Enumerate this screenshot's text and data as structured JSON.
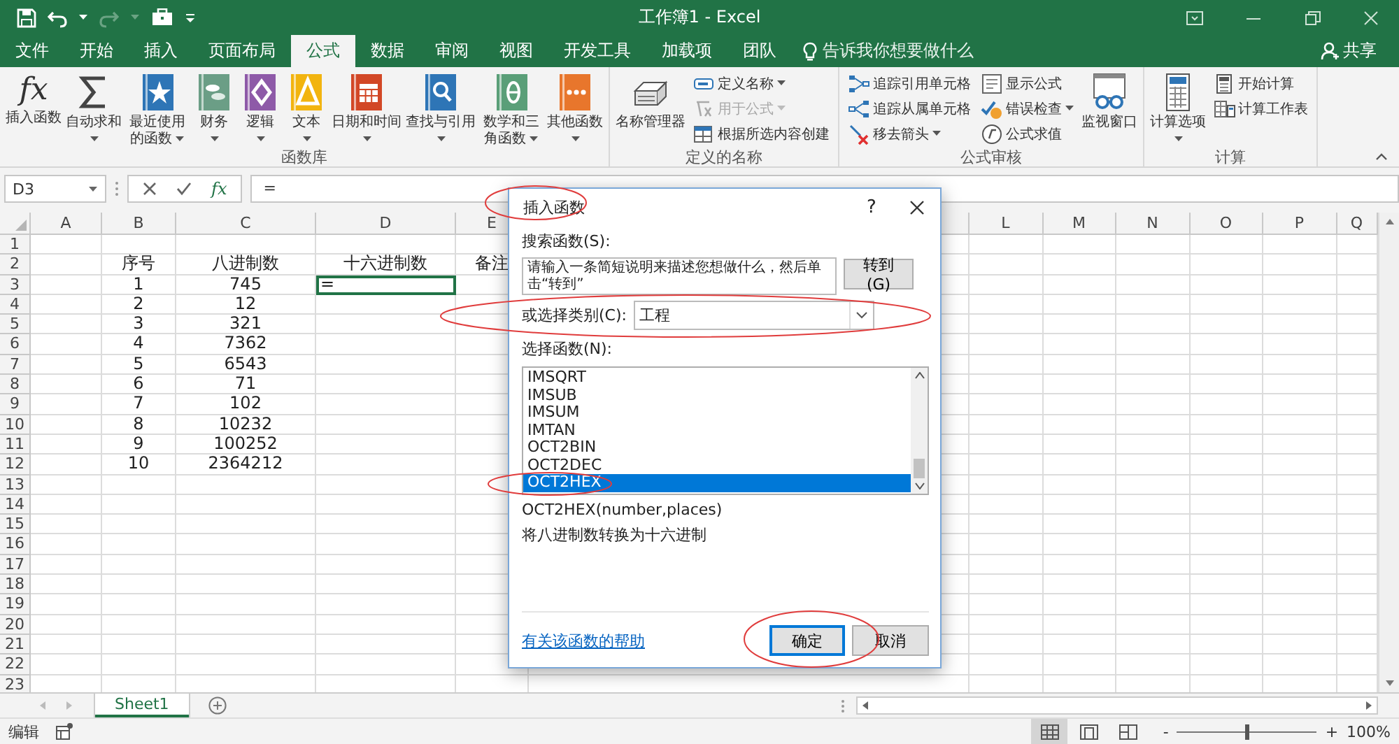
{
  "window": {
    "title": "工作簿1 - Excel"
  },
  "tabs": [
    {
      "label": "文件",
      "selected": false
    },
    {
      "label": "开始",
      "selected": false
    },
    {
      "label": "插入",
      "selected": false
    },
    {
      "label": "页面布局",
      "selected": false
    },
    {
      "label": "公式",
      "selected": true
    },
    {
      "label": "数据",
      "selected": false
    },
    {
      "label": "审阅",
      "selected": false
    },
    {
      "label": "视图",
      "selected": false
    },
    {
      "label": "开发工具",
      "selected": false
    },
    {
      "label": "加载项",
      "selected": false
    },
    {
      "label": "团队",
      "selected": false
    }
  ],
  "tell_me": {
    "placeholder": "告诉我你想要做什么"
  },
  "share": "共享",
  "ribbon": {
    "groups": [
      {
        "label": "函数库",
        "items": [
          {
            "kind": "large",
            "label": "插入函数",
            "glyph": "fx",
            "dropdown": false,
            "disabled": false
          },
          {
            "kind": "large",
            "label": "自动求和",
            "dropdown": true,
            "disabled": false
          },
          {
            "kind": "large",
            "label": "最近使用的函数",
            "dropdown": true,
            "disabled": false
          },
          {
            "kind": "large",
            "label": "财务",
            "dropdown": true,
            "disabled": false
          },
          {
            "kind": "large",
            "label": "逻辑",
            "dropdown": true,
            "disabled": false
          },
          {
            "kind": "large",
            "label": "文本",
            "dropdown": true,
            "disabled": false
          },
          {
            "kind": "large",
            "label": "日期和时间",
            "dropdown": true,
            "disabled": false
          },
          {
            "kind": "large",
            "label": "查找与引用",
            "dropdown": true,
            "disabled": false
          },
          {
            "kind": "large",
            "label": "数学和三角函数",
            "dropdown": true,
            "disabled": false
          },
          {
            "kind": "large",
            "label": "其他函数",
            "dropdown": true,
            "disabled": false
          }
        ]
      },
      {
        "label": "定义的名称",
        "items": [
          {
            "kind": "large",
            "label": "名称管理器",
            "dropdown": false,
            "disabled": false
          },
          {
            "kind": "small",
            "label": "定义名称",
            "dropdown": true,
            "disabled": false
          },
          {
            "kind": "small",
            "label": "用于公式",
            "dropdown": true,
            "disabled": true
          },
          {
            "kind": "small",
            "label": "根据所选内容创建",
            "dropdown": false,
            "disabled": false
          }
        ]
      },
      {
        "label": "公式审核",
        "items": [
          {
            "kind": "small",
            "label": "追踪引用单元格",
            "dropdown": false,
            "disabled": false
          },
          {
            "kind": "small",
            "label": "追踪从属单元格",
            "dropdown": false,
            "disabled": false
          },
          {
            "kind": "small",
            "label": "移去箭头",
            "dropdown": true,
            "disabled": false
          },
          {
            "kind": "small",
            "label": "显示公式",
            "dropdown": false,
            "disabled": false
          },
          {
            "kind": "small",
            "label": "错误检查",
            "dropdown": true,
            "disabled": false
          },
          {
            "kind": "small",
            "label": "公式求值",
            "dropdown": false,
            "disabled": false
          },
          {
            "kind": "large",
            "label": "监视窗口",
            "dropdown": false,
            "disabled": false
          }
        ]
      },
      {
        "label": "计算",
        "items": [
          {
            "kind": "large",
            "label": "计算选项",
            "dropdown": true,
            "disabled": false
          },
          {
            "kind": "small",
            "label": "开始计算",
            "dropdown": false,
            "disabled": false
          },
          {
            "kind": "small",
            "label": "计算工作表",
            "dropdown": false,
            "disabled": false
          }
        ]
      }
    ]
  },
  "formula_bar": {
    "name_box": "D3",
    "fx": "fx",
    "formula": "="
  },
  "sheet": {
    "columns": [
      "A",
      "B",
      "C",
      "D",
      "E",
      "L",
      "M",
      "N",
      "O",
      "P",
      "Q"
    ],
    "rows": [
      {
        "number": "1"
      },
      {
        "number": "2",
        "cells": [
          "序号",
          "八进制数",
          "十六进制数",
          "备注"
        ]
      },
      {
        "number": "3",
        "cells": [
          "1",
          "745",
          {
            "text": "=",
            "selected": true
          }
        ]
      },
      {
        "number": "4",
        "cells": [
          "2",
          "12"
        ]
      },
      {
        "number": "5",
        "cells": [
          "3",
          "321"
        ]
      },
      {
        "number": "6",
        "cells": [
          "4",
          "7362"
        ]
      },
      {
        "number": "7",
        "cells": [
          "5",
          "6543"
        ]
      },
      {
        "number": "8",
        "cells": [
          "6",
          "71"
        ]
      },
      {
        "number": "9",
        "cells": [
          "7",
          "102"
        ]
      },
      {
        "number": "10",
        "cells": [
          "8",
          "10232"
        ]
      },
      {
        "number": "11",
        "cells": [
          "9",
          "100252"
        ]
      },
      {
        "number": "12",
        "cells": [
          "10",
          "2364212"
        ]
      },
      {
        "number": "13"
      },
      {
        "number": "14"
      },
      {
        "number": "15"
      },
      {
        "number": "16"
      },
      {
        "number": "17"
      },
      {
        "number": "18"
      },
      {
        "number": "19"
      },
      {
        "number": "20"
      },
      {
        "number": "21"
      },
      {
        "number": "22"
      },
      {
        "number": "23"
      }
    ]
  },
  "dialog": {
    "title": "插入函数",
    "help": "?",
    "search_label": "搜索函数(S):",
    "search_value": "请输入一条简短说明来描述您想做什么，然后单击“转到”",
    "go_button": "转到(G)",
    "category_label": "或选择类别(C):",
    "category_value": "工程",
    "list_label": "选择函数(N):",
    "functions": [
      {
        "label": "IMSQRT",
        "selected": false
      },
      {
        "label": "IMSUB",
        "selected": false
      },
      {
        "label": "IMSUM",
        "selected": false
      },
      {
        "label": "IMTAN",
        "selected": false
      },
      {
        "label": "OCT2BIN",
        "selected": false
      },
      {
        "label": "OCT2DEC",
        "selected": false
      },
      {
        "label": "OCT2HEX",
        "selected": true
      }
    ],
    "signature": "OCT2HEX(number,places)",
    "description": "将八进制数转换为十六进制",
    "help_link": "有关该函数的帮助",
    "buttons": [
      {
        "label": "确定",
        "default": true
      },
      {
        "label": "取消",
        "default": false
      }
    ]
  },
  "sheet_tabs": [
    {
      "label": "Sheet1",
      "selected": true
    }
  ],
  "status_bar": {
    "mode": "编辑",
    "views": [
      {
        "selected": true
      },
      {
        "selected": false
      },
      {
        "selected": false
      }
    ],
    "zoom": {
      "minus": "-",
      "plus": "+",
      "level": 0.5,
      "percent": "100%"
    }
  }
}
